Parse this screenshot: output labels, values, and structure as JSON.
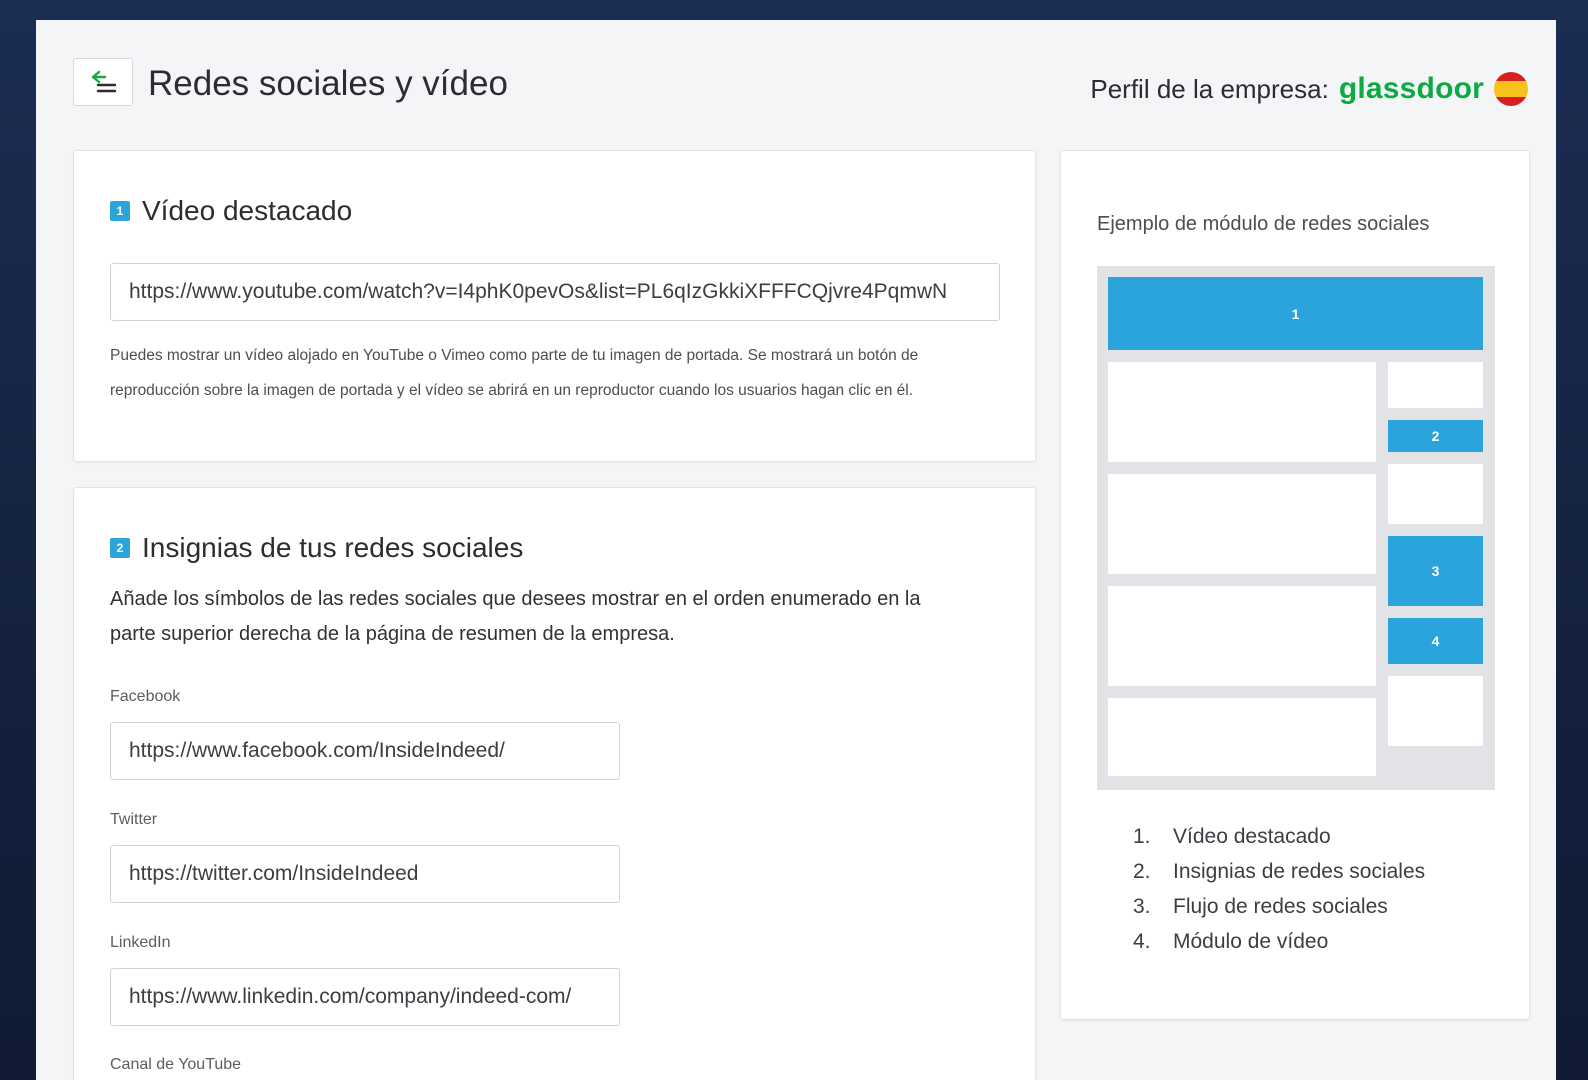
{
  "header": {
    "title": "Redes sociales y vídeo",
    "profile_label": "Perfil de la empresa:",
    "brand": "glassdoor"
  },
  "section1": {
    "number": "1",
    "title": "Vídeo destacado",
    "video_url": "https://www.youtube.com/watch?v=I4phK0pevOs&list=PL6qIzGkkiXFFFCQjvre4PqmwN",
    "help_line1": "Puedes mostrar un vídeo alojado en YouTube o Vimeo como parte de tu imagen de portada. Se mostrará un botón de",
    "help_line2": "reproducción sobre la imagen de portada y el vídeo se abrirá en un reproductor cuando los usuarios hagan clic en él."
  },
  "section2": {
    "number": "2",
    "title": "Insignias de tus redes sociales",
    "description_line1": "Añade los símbolos de las redes sociales que desees mostrar en el orden enumerado en la",
    "description_line2": "parte superior derecha de la página de resumen de la empresa.",
    "fields": [
      {
        "label": "Facebook",
        "value": "https://www.facebook.com/InsideIndeed/"
      },
      {
        "label": "Twitter",
        "value": "https://twitter.com/InsideIndeed"
      },
      {
        "label": "LinkedIn",
        "value": "https://www.linkedin.com/company/indeed-com/"
      },
      {
        "label": "Canal de YouTube",
        "value": ""
      }
    ]
  },
  "example": {
    "title": "Ejemplo de módulo de redes sociales",
    "blocks": [
      "1",
      "2",
      "3",
      "4"
    ],
    "legend": [
      {
        "n": "1.",
        "text": "Vídeo destacado"
      },
      {
        "n": "2.",
        "text": "Insignias de redes sociales"
      },
      {
        "n": "3.",
        "text": "Flujo de redes sociales"
      },
      {
        "n": "4.",
        "text": "Módulo de vídeo"
      }
    ]
  },
  "colors": {
    "accent_blue": "#2aa4db",
    "brand_green": "#0caa41",
    "background_navy": "#1b2d52"
  },
  "icons": {
    "back": "back-menu-icon",
    "flag": "spain-flag-icon"
  }
}
